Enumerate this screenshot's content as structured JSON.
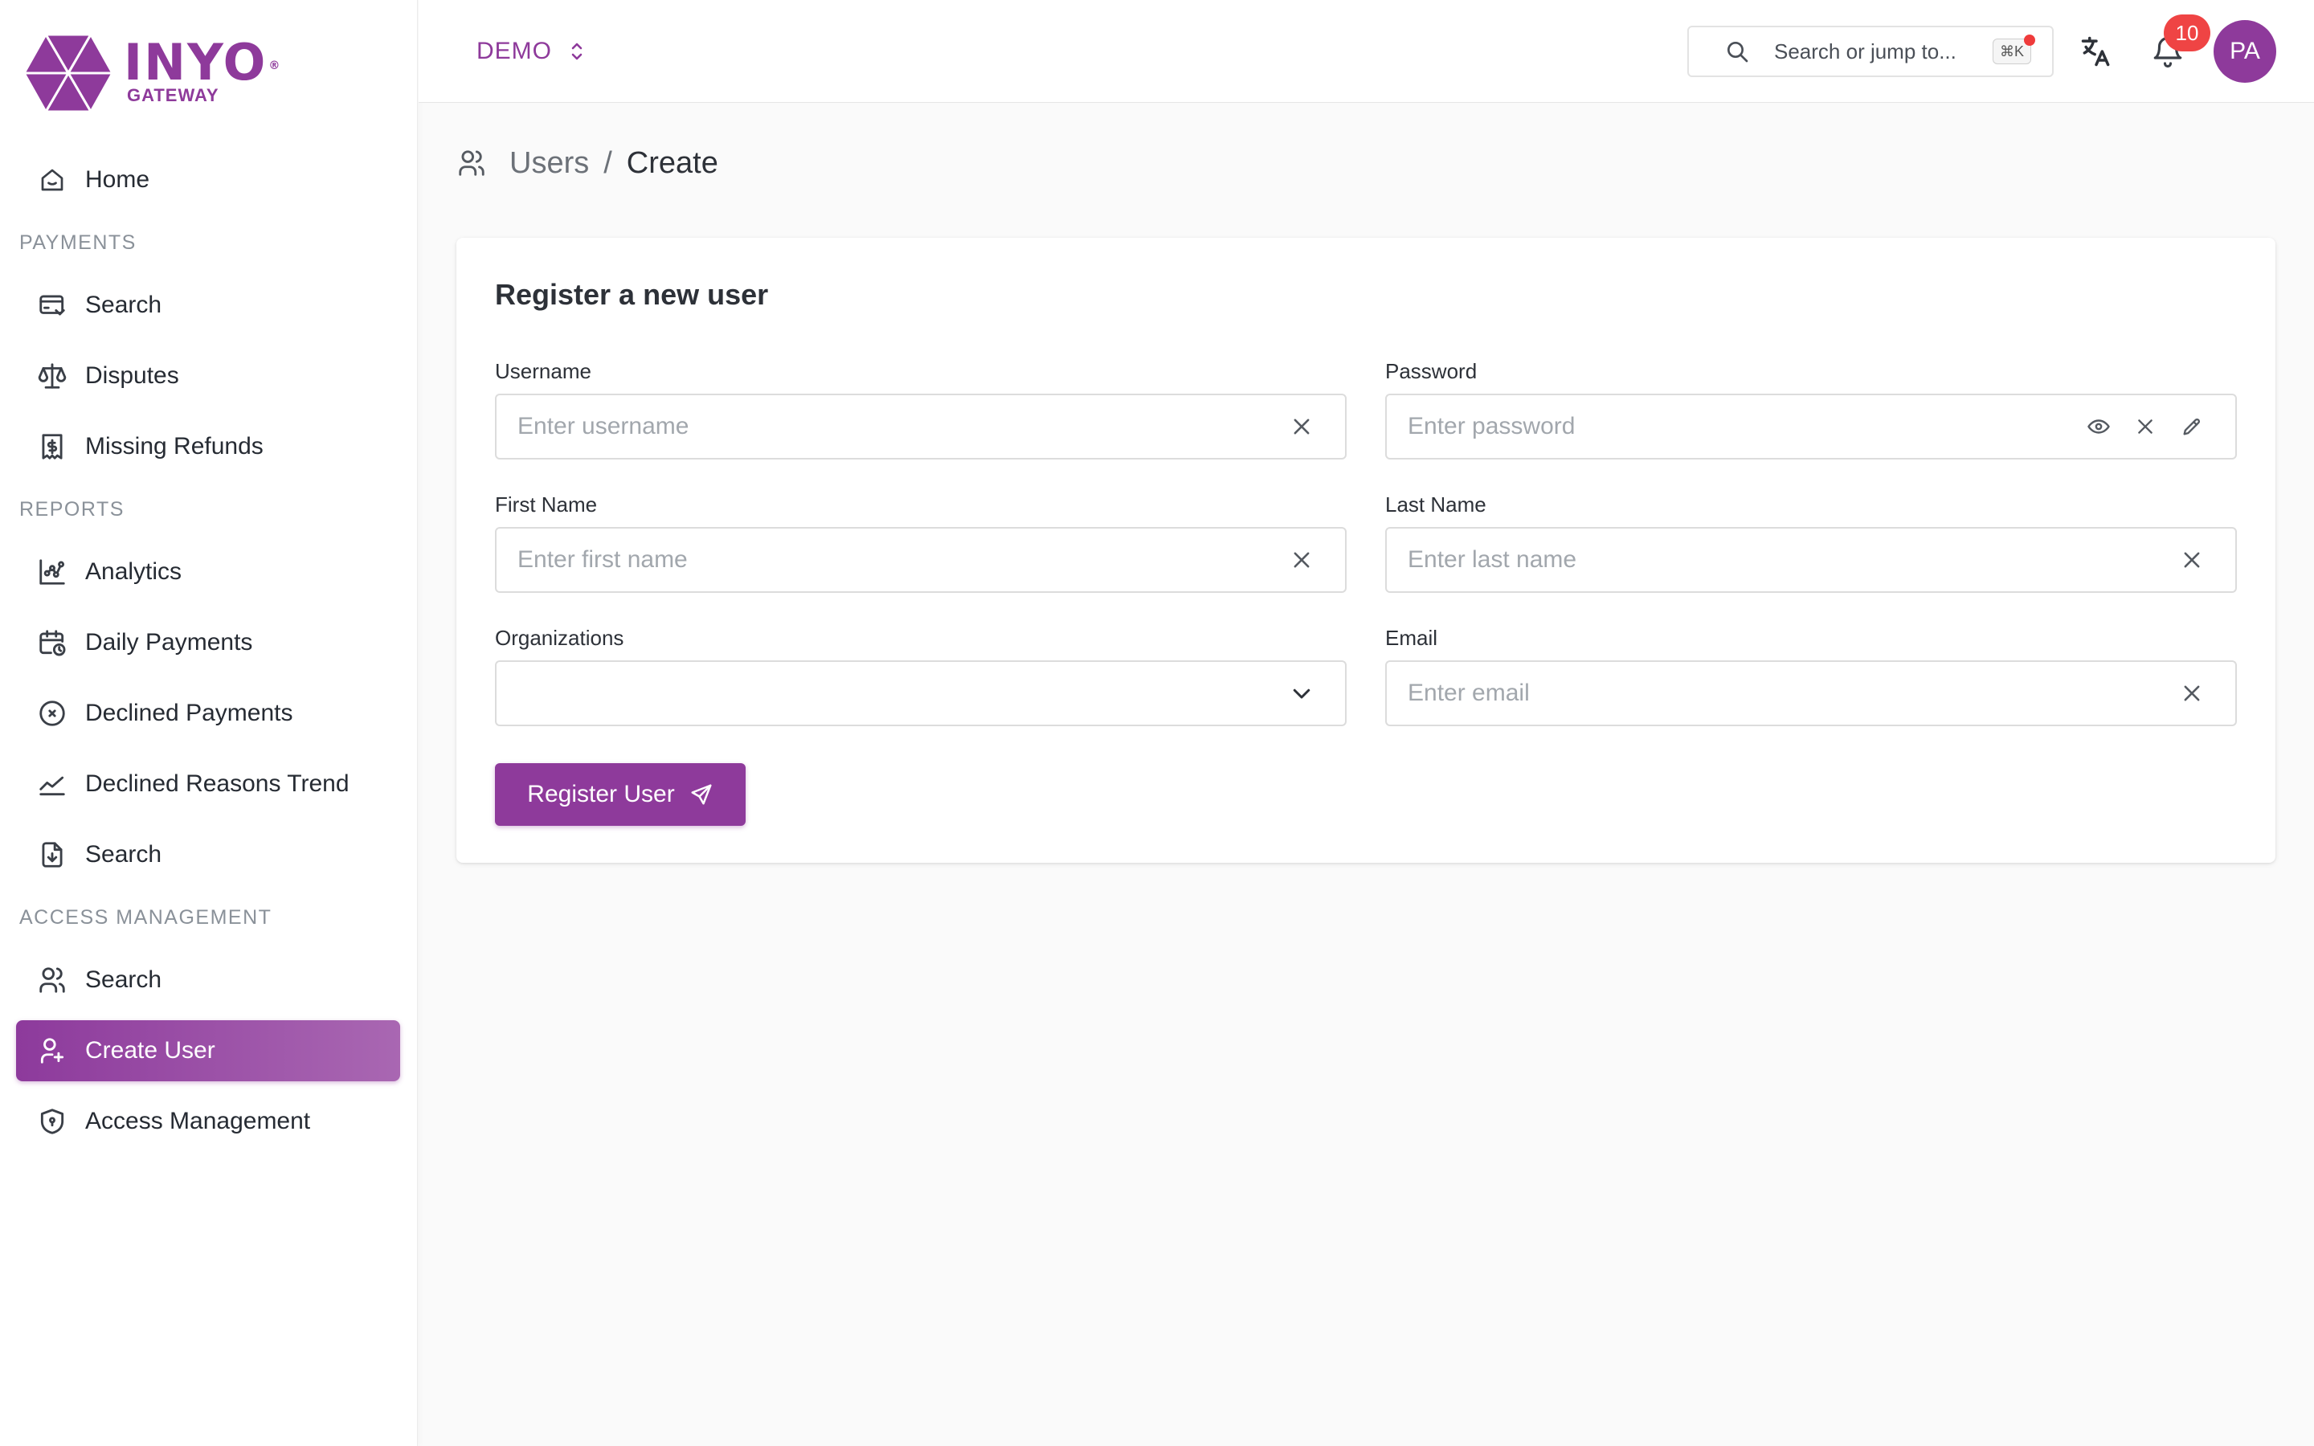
{
  "brand": {
    "name": "INYO",
    "registered": "®",
    "subtitle": "GATEWAY",
    "color": "#8e3a9b"
  },
  "sidebar": {
    "home": {
      "label": "Home",
      "icon": "home-icon"
    },
    "sections": [
      {
        "title": "PAYMENTS",
        "items": [
          {
            "label": "Search",
            "icon": "card-search-icon"
          },
          {
            "label": "Disputes",
            "icon": "scale-icon"
          },
          {
            "label": "Missing Refunds",
            "icon": "receipt-icon"
          }
        ]
      },
      {
        "title": "REPORTS",
        "items": [
          {
            "label": "Analytics",
            "icon": "analytics-icon"
          },
          {
            "label": "Daily Payments",
            "icon": "calendar-clock-icon"
          },
          {
            "label": "Declined Payments",
            "icon": "x-circle-icon"
          },
          {
            "label": "Declined Reasons Trend",
            "icon": "trend-icon"
          },
          {
            "label": "Search",
            "icon": "file-download-icon"
          }
        ]
      },
      {
        "title": "ACCESS MANAGEMENT",
        "items": [
          {
            "label": "Search",
            "icon": "users-icon"
          },
          {
            "label": "Create User",
            "icon": "user-plus-icon",
            "active": true
          },
          {
            "label": "Access Management",
            "icon": "shield-icon"
          }
        ]
      }
    ]
  },
  "header": {
    "environment": "DEMO",
    "search": {
      "placeholder": "Search or jump to...",
      "shortcut": "⌘K"
    },
    "notifications": {
      "count": "10"
    },
    "avatar": {
      "initials": "PA"
    }
  },
  "breadcrumb": {
    "parent": "Users",
    "separator": "/",
    "current": "Create"
  },
  "form": {
    "title": "Register a new user",
    "username": {
      "label": "Username",
      "placeholder": "Enter username",
      "value": ""
    },
    "password": {
      "label": "Password",
      "placeholder": "Enter password",
      "value": ""
    },
    "first_name": {
      "label": "First Name",
      "placeholder": "Enter first name",
      "value": ""
    },
    "last_name": {
      "label": "Last Name",
      "placeholder": "Enter last name",
      "value": ""
    },
    "organizations": {
      "label": "Organizations",
      "value": ""
    },
    "email": {
      "label": "Email",
      "placeholder": "Enter email",
      "value": ""
    },
    "submit_label": "Register User"
  },
  "colors": {
    "accent": "#8e3a9b",
    "badge": "#ef4444",
    "background": "#fafafa"
  }
}
